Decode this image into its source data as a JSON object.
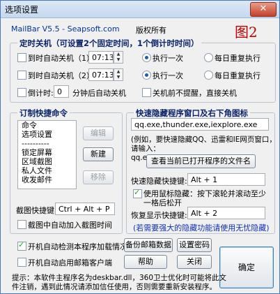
{
  "window": {
    "title": "选项设置",
    "close_label": "✕",
    "app_name": "MailBar V5.5 - Seapsoft.com",
    "copyright": "版权所有",
    "figure_label": "图2"
  },
  "timer_shutdown": {
    "title": "定时关机（可设置2个固定时间，1个倒计时时间）",
    "fixed1": {
      "label": "到时自动关机（1）",
      "time": "07:13",
      "opt_once": "执行一次",
      "opt_daily": "每日重复执行"
    },
    "fixed2": {
      "label": "到时自动关机（2）",
      "time": "07:13",
      "opt_once": "执行一次",
      "opt_daily": "每日重复执行"
    },
    "countdown": {
      "label": "倒计时:",
      "value": "0",
      "suffix": "分钟后自动关机"
    },
    "no_remind": "关机前不提醒，直接关机"
  },
  "shortcut_cmds": {
    "title": "订制快捷命令",
    "items": [
      "命令",
      "选项设置",
      "----------",
      "锁定屏幕",
      "区域截图",
      "私人文件",
      "收发邮件"
    ],
    "edit_label": "编辑",
    "new_label": "新建",
    "remove_label": "移除",
    "screenshot_hotkey_label": "截图快捷键:",
    "screenshot_hotkey_value": "Ctrl + Alt + P",
    "auto_time_label": "截图中自动加入截图时间"
  },
  "hide_window": {
    "title": "快速隐藏程序窗口及右下角图标",
    "exe_value": "qq.exe,thunder.exe,iexplore.exe",
    "example_line1": "(例如，要快速隐藏QQ、迅雷和IE网页窗口，",
    "example_line2": "请输入：qq.exe,thunder.exe,iexplore.exe)",
    "view_btn": "查看当前已打开程序的文件名",
    "hide_hotkey_label": "快速隐藏快捷键:",
    "hide_hotkey_value": "Alt + 1",
    "mouse_wheel_label1": "使用鼠标隐藏：按下滚轮并滚动至少",
    "mouse_wheel_label2": "一格后松开",
    "restore_hotkey_label": "恢复显示快捷键:",
    "restore_hotkey_value": "Alt + 2",
    "note": "(若需要强大的隐藏功能请使用无忧隐藏)"
  },
  "bottom": {
    "check_load_label": "开机自动检测本程序加载情况",
    "check_mail_label": "开机自动启用邮箱客户端",
    "backup_btn": "备份邮箱数据",
    "password_btn": "设置密码",
    "help_btn": "帮助",
    "close_btn": "关闭",
    "ok_btn": "确定",
    "tip_line1": "提示：本软件主程序名为deskbar.dll，360卫士优化时可能将此文",
    "tip_line2": "件注销，遇到此情况请添加信任使用，否则需要重新安装程序。"
  },
  "colors": {
    "accent": "#1030b8",
    "red": "#c00000"
  }
}
